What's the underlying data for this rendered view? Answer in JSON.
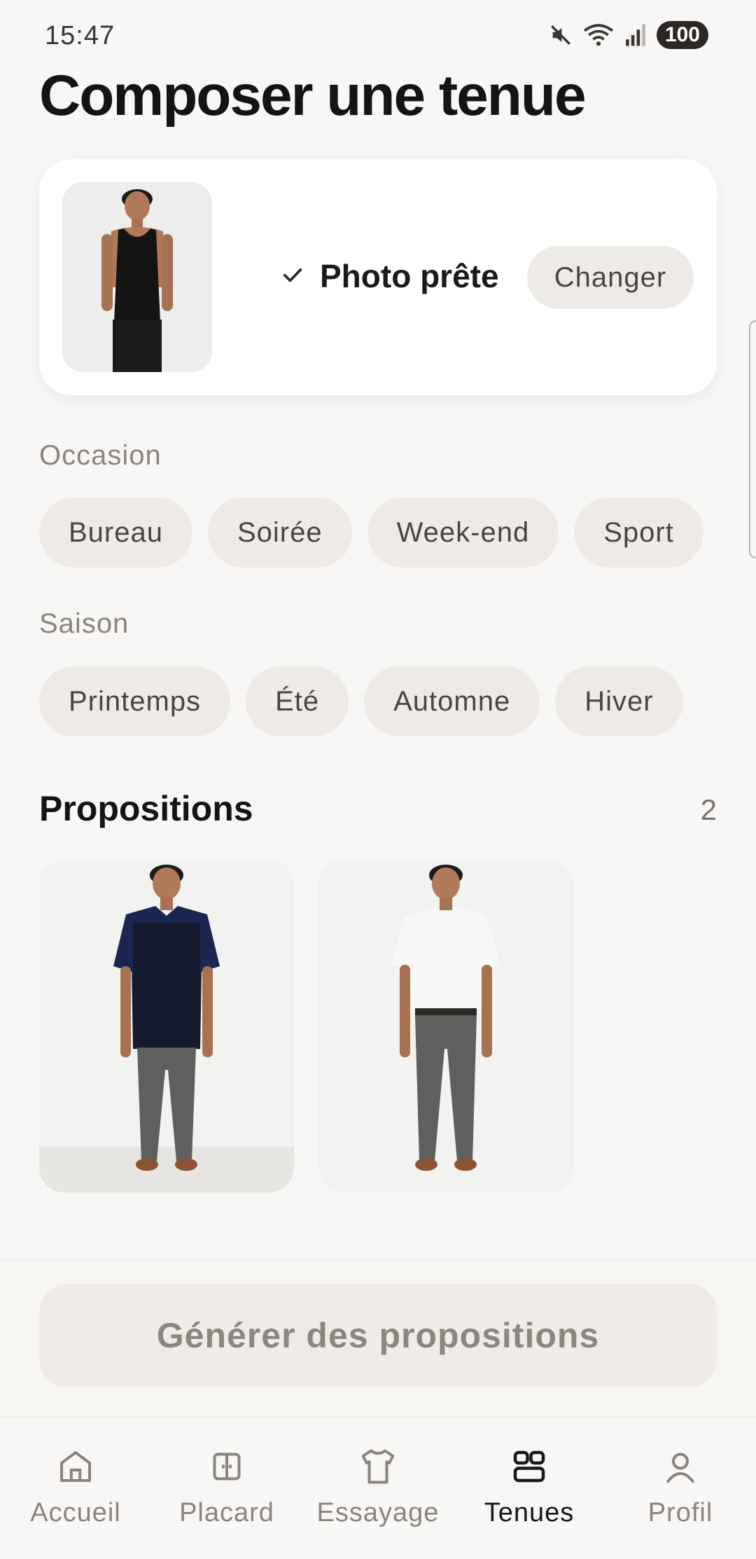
{
  "status_bar": {
    "time": "15:47",
    "battery": "100",
    "icons": [
      "mute-icon",
      "wifi-icon",
      "signal-icon",
      "battery-icon"
    ]
  },
  "page": {
    "title": "Composer une tenue"
  },
  "photo_card": {
    "status_label": "Photo prête",
    "status_icon": "check-icon",
    "change_label": "Changer"
  },
  "occasion": {
    "label": "Occasion",
    "chips": [
      "Bureau",
      "Soirée",
      "Week-end",
      "Sport"
    ]
  },
  "season": {
    "label": "Saison",
    "chips": [
      "Printemps",
      "Été",
      "Automne",
      "Hiver"
    ]
  },
  "proposals": {
    "title": "Propositions",
    "count": "2"
  },
  "generate": {
    "label": "Générer des propositions"
  },
  "bottom_nav": {
    "items": [
      {
        "label": "Accueil",
        "icon": "home-icon"
      },
      {
        "label": "Placard",
        "icon": "wardrobe-icon"
      },
      {
        "label": "Essayage",
        "icon": "tshirt-icon"
      },
      {
        "label": "Tenues",
        "icon": "outfits-icon"
      },
      {
        "label": "Profil",
        "icon": "profile-icon"
      }
    ],
    "active": "Tenues"
  },
  "colors": {
    "background": "#f8f7f5",
    "chip": "#eeebe7",
    "text": "#1a1816",
    "muted": "#8a847f"
  }
}
